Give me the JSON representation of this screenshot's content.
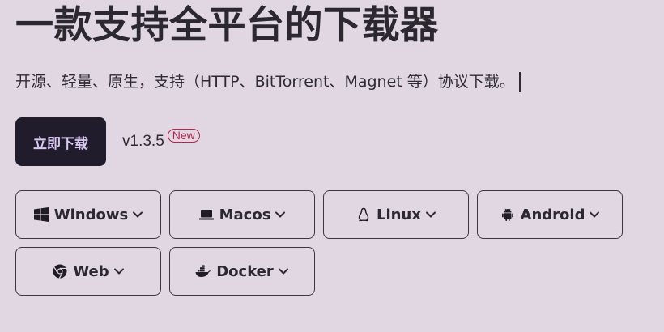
{
  "hero": {
    "title": "一款支持全平台的下载器",
    "subtitle": "开源、轻量、原生，支持（HTTP、BitTorrent、Magnet 等）协议下载。"
  },
  "download": {
    "button_label": "立即下载",
    "version": "v1.3.5",
    "badge": "New"
  },
  "platforms": [
    {
      "label": "Windows",
      "icon": "windows-icon"
    },
    {
      "label": "Macos",
      "icon": "laptop-icon"
    },
    {
      "label": "Linux",
      "icon": "linux-icon"
    },
    {
      "label": "Android",
      "icon": "android-icon"
    },
    {
      "label": "Web",
      "icon": "chrome-icon"
    },
    {
      "label": "Docker",
      "icon": "docker-icon"
    }
  ],
  "colors": {
    "background": "#e0d7e3",
    "button_bg": "#211c2c",
    "button_text": "#d9c9f0",
    "badge": "#b3274a",
    "text": "#2b2830"
  }
}
